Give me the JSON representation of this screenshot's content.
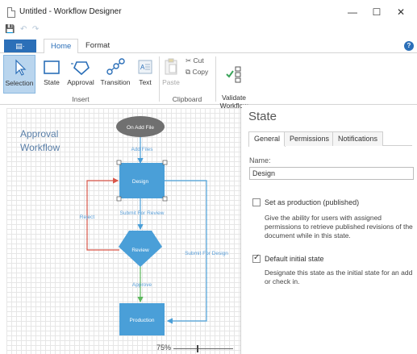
{
  "window": {
    "title": "Untitled - Workflow Designer",
    "minimize": "—",
    "maximize": "☐",
    "close": "✕"
  },
  "qat": {
    "save": "💾",
    "undo": "↶",
    "redo": "↷"
  },
  "ribbon": {
    "file_tab": "▤·",
    "tabs": [
      "Home",
      "Format"
    ],
    "groups": [
      {
        "label": "Insert",
        "buttons": [
          "Selection",
          "State",
          "Approval",
          "Transition",
          "Text"
        ]
      },
      {
        "label": "Clipboard",
        "buttons": [
          "Paste"
        ],
        "small": [
          "Cut",
          "Copy"
        ]
      },
      {
        "label": "",
        "buttons": [
          "Validate\nWorkflow"
        ]
      }
    ]
  },
  "canvas": {
    "title": "Approval\nWorkflow",
    "nodes": {
      "on_add": "On Add File",
      "design": "Design",
      "review": "Review",
      "production": "Production"
    },
    "edges": {
      "add_files": "Add Files",
      "submit_review": "Submit For Review",
      "reject": "Reject",
      "submit_design": "Submit For Design",
      "approve": "Approve"
    },
    "zoom": "75%"
  },
  "panel": {
    "title": "State",
    "tabs": [
      "General",
      "Permissions",
      "Notifications"
    ],
    "name_label": "Name:",
    "name_value": "Design",
    "production_label": "Set as production (published)",
    "production_desc": "Give the ability for users with assigned permissions to retrieve published revisions of the document while in this state.",
    "default_label": "Default initial state",
    "default_desc": "Designate this state as the initial state for an add or check in.",
    "production_checked": false,
    "default_checked": true
  },
  "colors": {
    "accent": "#2b6fb8",
    "node": "#4a9fd8",
    "start": "#707070",
    "reject": "#d9574a",
    "approve": "#5cb85c"
  }
}
